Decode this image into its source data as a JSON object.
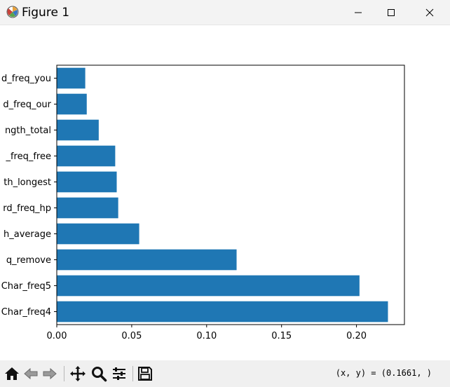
{
  "window": {
    "title": "Figure 1"
  },
  "toolbar": {
    "buttons": [
      "home-icon",
      "back-icon",
      "forward-icon",
      "pan-icon",
      "zoom-icon",
      "configure-icon",
      "save-icon"
    ],
    "coords_text": "(x, y) = (0.1661, )"
  },
  "chart_data": {
    "type": "bar",
    "orientation": "horizontal",
    "categories": [
      "Char_freq4",
      "Char_freq5",
      "q_remove",
      "h_average",
      "rd_freq_hp",
      "th_longest",
      "_freq_free",
      "ngth_total",
      "d_freq_our",
      "d_freq_you"
    ],
    "values": [
      0.221,
      0.202,
      0.12,
      0.055,
      0.041,
      0.04,
      0.039,
      0.028,
      0.02,
      0.019
    ],
    "xlim": [
      0.0,
      0.232
    ],
    "xticks": [
      "0.00",
      "0.05",
      "0.10",
      "0.15",
      "0.20"
    ],
    "xtick_values": [
      0.0,
      0.05,
      0.1,
      0.15,
      0.2
    ],
    "bar_color": "#1f77b4",
    "grid": false,
    "title": "",
    "xlabel": "",
    "ylabel": ""
  }
}
